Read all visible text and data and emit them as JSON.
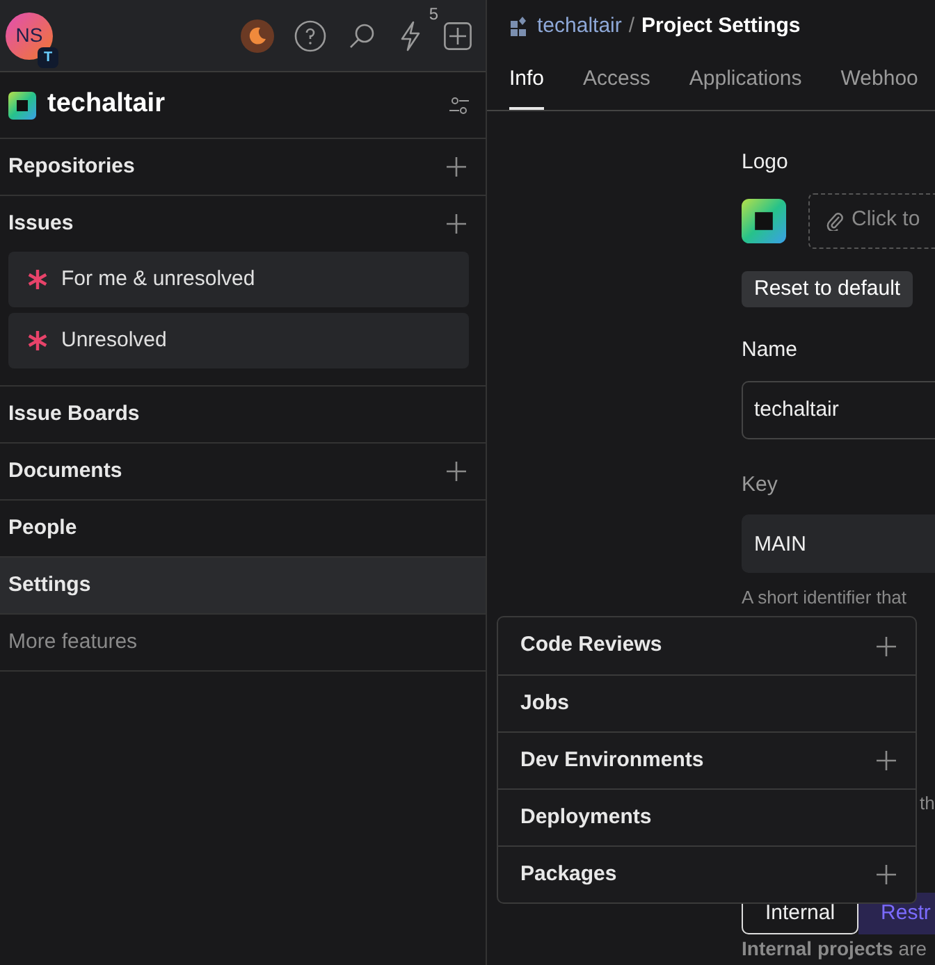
{
  "topbar": {
    "avatar": "NS",
    "avatar_badge": "T",
    "notifications": "5"
  },
  "project": {
    "name": "techaltair"
  },
  "sidebar": [
    {
      "label": "Repositories",
      "kind": "section",
      "add": true,
      "selected": false
    },
    {
      "label": "Issues",
      "kind": "section",
      "add": true,
      "selected": false,
      "children": [
        {
          "label": "For me & unresolved"
        },
        {
          "label": "Unresolved"
        }
      ]
    },
    {
      "label": "Issue Boards",
      "kind": "section",
      "add": false,
      "selected": false
    },
    {
      "label": "Documents",
      "kind": "section",
      "add": true,
      "selected": false
    },
    {
      "label": "People",
      "kind": "section",
      "add": false,
      "selected": false
    },
    {
      "label": "Settings",
      "kind": "section",
      "add": false,
      "selected": true
    },
    {
      "label": "More features",
      "kind": "more",
      "add": false,
      "selected": false
    }
  ],
  "breadcrumb": {
    "parent": "techaltair",
    "separator": "/",
    "current": "Project Settings"
  },
  "tabs": [
    {
      "label": "Info",
      "selected": true
    },
    {
      "label": "Access",
      "selected": false
    },
    {
      "label": "Applications",
      "selected": false
    },
    {
      "label": "Webhoo",
      "selected": false
    }
  ],
  "form": {
    "logo_label": "Logo",
    "upload": "Click to",
    "reset": "Reset to default",
    "name_label": "Name",
    "name_value": "techaltair",
    "key_label": "Key",
    "key_value": "MAIN",
    "key_hint": "A short identifier that",
    "hidden_hint": "th",
    "visibility": [
      {
        "label": "Internal",
        "selected": true
      },
      {
        "label": "Restr",
        "selected": false
      }
    ],
    "visibility_hint": "**Internal projects** are"
  },
  "more_features": [
    {
      "label": "Code Reviews",
      "add": true
    },
    {
      "label": "Jobs",
      "add": false
    },
    {
      "label": "Dev Environments",
      "add": true
    },
    {
      "label": "Deployments",
      "add": false
    },
    {
      "label": "Packages",
      "add": true
    }
  ]
}
